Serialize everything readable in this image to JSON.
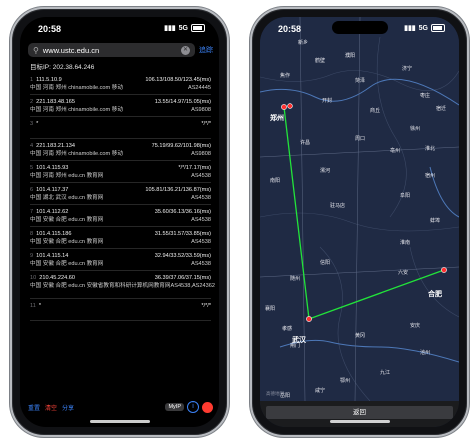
{
  "left": {
    "status": {
      "time": "20:58",
      "signal": "5G"
    },
    "url": {
      "value": "www.ustc.edu.cn",
      "go_label": "追踪"
    },
    "target": "目标IP: 202.38.64.246",
    "hops": [
      {
        "num": "1",
        "ip": "111.5.10.9",
        "rtt": "106.13/108.50/123.45(ms)",
        "loc": "中国 河南 郑州 chinamobile.com 移动",
        "as": "AS24445"
      },
      {
        "num": "2",
        "ip": "221.183.48.165",
        "rtt": "13.55/14.97/15.05(ms)",
        "loc": "中国 河南 郑州 chinamobile.com 移动",
        "as": "AS9808"
      },
      {
        "num": "3",
        "ip": "*",
        "rtt": "*/*/*",
        "loc": "",
        "as": ""
      },
      {
        "num": "4",
        "ip": "221.183.21.134",
        "rtt": "75.19/99.62/101.98(ms)",
        "loc": "中国 河南 郑州 chinamobile.com 移动",
        "as": "AS9808"
      },
      {
        "num": "5",
        "ip": "101.4.115.93",
        "rtt": "*/*/17.17(ms)",
        "loc": "中国 河南 郑州 edu.cn 教育网",
        "as": "AS4538"
      },
      {
        "num": "6",
        "ip": "101.4.117.37",
        "rtt": "105.81/136.21/136.87(ms)",
        "loc": "中国 湖北 武汉 edu.cn 教育网",
        "as": "AS4538"
      },
      {
        "num": "7",
        "ip": "101.4.112.62",
        "rtt": "35.60/36.13/36.16(ms)",
        "loc": "中国 安徽 合肥 edu.cn 教育网",
        "as": "AS4538"
      },
      {
        "num": "8",
        "ip": "101.4.115.186",
        "rtt": "31.55/31.57/33.85(ms)",
        "loc": "中国 安徽 合肥 edu.cn 教育网",
        "as": "AS4538"
      },
      {
        "num": "9",
        "ip": "101.4.115.14",
        "rtt": "32.94/33.52/33.59(ms)",
        "loc": "中国 安徽 合肥 edu.cn 教育网",
        "as": "AS4538"
      },
      {
        "num": "10",
        "ip": "210.45.224.60",
        "rtt": "36.39/37.06/37.15(ms)",
        "loc": "中国 安徽 合肥 edu.cn 安徽省教育和科研计算机网教育网",
        "as": "AS4538,AS24362"
      },
      {
        "num": "11",
        "ip": "*",
        "rtt": "*/*/*",
        "loc": "",
        "as": ""
      }
    ],
    "bottom": {
      "select": "重置",
      "clear": "清空",
      "share": "分享",
      "myip": "MyIP",
      "info": "i"
    }
  },
  "right": {
    "status": {
      "time": "20:58",
      "signal": "5G"
    },
    "map_cities": [
      {
        "name": "新乡"
      },
      {
        "name": "鹤壁"
      },
      {
        "name": "濮阳"
      },
      {
        "name": "焦作"
      },
      {
        "name": "菏泽"
      },
      {
        "name": "济宁"
      },
      {
        "name": "枣庄"
      },
      {
        "name": "开封"
      },
      {
        "name": "商丘"
      },
      {
        "name": "徐州"
      },
      {
        "name": "宿迁"
      },
      {
        "name": "许昌"
      },
      {
        "name": "周口"
      },
      {
        "name": "亳州"
      },
      {
        "name": "淮北"
      },
      {
        "name": "宿州"
      },
      {
        "name": "漯河"
      },
      {
        "name": "阜阳"
      },
      {
        "name": "蚌埠"
      },
      {
        "name": "南阳"
      },
      {
        "name": "驻马店"
      },
      {
        "name": "淮南"
      },
      {
        "name": "信阳"
      },
      {
        "name": "随州"
      },
      {
        "name": "六安"
      },
      {
        "name": "襄阳"
      },
      {
        "name": "孝感"
      },
      {
        "name": "黄冈"
      },
      {
        "name": "荆门"
      },
      {
        "name": "安庆"
      },
      {
        "name": "池州"
      },
      {
        "name": "鄂州"
      },
      {
        "name": "咸宁"
      },
      {
        "name": "九江"
      },
      {
        "name": "岳阳"
      }
    ],
    "big_cities": [
      {
        "name": "郑州"
      },
      {
        "name": "武汉"
      },
      {
        "name": "合肥"
      }
    ],
    "route_color": "#22e33a",
    "brand": "高德地图",
    "return_label": "返回"
  }
}
